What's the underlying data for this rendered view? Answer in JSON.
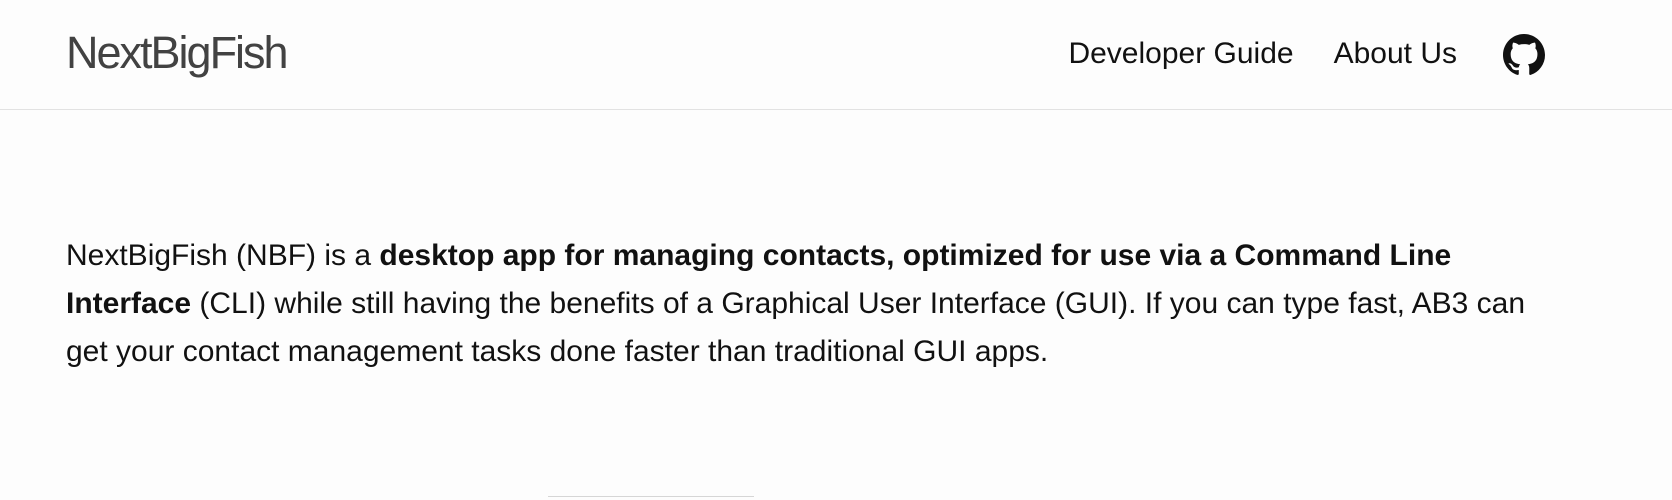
{
  "header": {
    "brand": "NextBigFish",
    "nav_links": [
      {
        "label": "Developer Guide"
      },
      {
        "label": "About Us"
      }
    ],
    "github_icon": "github-icon"
  },
  "intro": {
    "part1": "NextBigFish (NBF) is a ",
    "bold": "desktop app for managing contacts, optimized for use via a Command Line Interface",
    "part2": " (CLI) while still having the benefits of a Graphical User Interface (GUI). If you can type fast, AB3 can get your contact management tasks done faster than traditional GUI apps."
  },
  "colors": {
    "brand": "#424242",
    "text": "#111111",
    "divider": "#e2e2e2",
    "background": "#fdfdfd"
  }
}
